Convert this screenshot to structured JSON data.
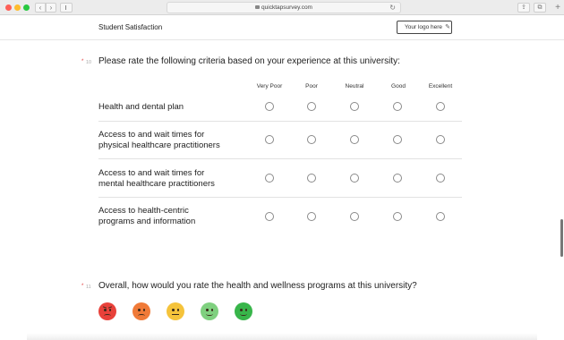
{
  "browser": {
    "url": "quicktapsurvey.com",
    "icons": [
      "back-icon",
      "forward-icon",
      "sidebar-icon",
      "lock-icon",
      "reload-icon",
      "share-icon",
      "tabs-icon",
      "plus-icon"
    ]
  },
  "survey": {
    "title": "Student Satisfaction",
    "logo_placeholder": "Your logo here"
  },
  "q10": {
    "required_mark": "*",
    "number": "10",
    "text": "Please rate the following criteria based on your experience at this university:",
    "columns": [
      "Very Poor",
      "Poor",
      "Neutral",
      "Good",
      "Excellent"
    ],
    "rows": [
      {
        "line1": "Health and dental plan",
        "line2": ""
      },
      {
        "line1": "Access to and wait times for",
        "line2": "physical healthcare practitioners"
      },
      {
        "line1": "Access to and wait times for",
        "line2": "mental healthcare practitioners"
      },
      {
        "line1": "Access to health-centric",
        "line2": "programs and information"
      }
    ]
  },
  "q11": {
    "required_mark": "*",
    "number": "11",
    "text": "Overall, how would you rate the health and wellness programs at this university?",
    "faces": [
      {
        "name": "very-dissatisfied-face-icon",
        "color": "#e8413a"
      },
      {
        "name": "dissatisfied-face-icon",
        "color": "#f07a38"
      },
      {
        "name": "neutral-face-icon",
        "color": "#f5c33b"
      },
      {
        "name": "satisfied-face-icon",
        "color": "#7fd07f"
      },
      {
        "name": "very-satisfied-face-icon",
        "color": "#38b54a"
      }
    ]
  }
}
